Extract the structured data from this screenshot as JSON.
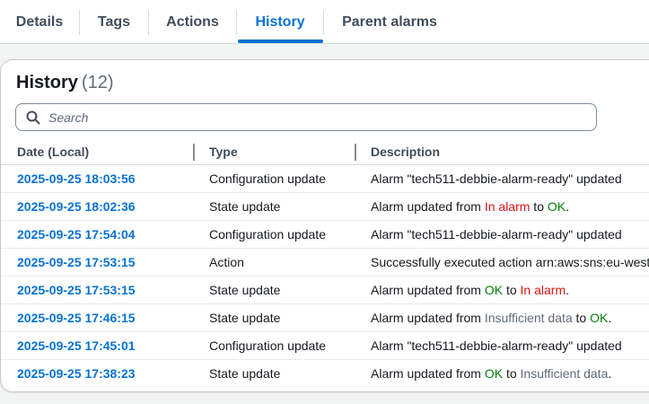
{
  "tabs": [
    {
      "label": "Details"
    },
    {
      "label": "Tags"
    },
    {
      "label": "Actions"
    },
    {
      "label": "History",
      "active": true
    },
    {
      "label": "Parent alarms"
    }
  ],
  "history": {
    "title": "History",
    "count": "(12)",
    "search_placeholder": "Search",
    "columns": {
      "date": "Date (Local)",
      "type": "Type",
      "description": "Description"
    },
    "rows": [
      {
        "date": "2025-09-25 18:03:56",
        "type": "Configuration update",
        "desc": [
          {
            "text": "Alarm \"tech511-debbie-alarm-ready\" updated"
          }
        ]
      },
      {
        "date": "2025-09-25 18:02:36",
        "type": "State update",
        "desc": [
          {
            "text": "Alarm updated from "
          },
          {
            "text": "In alarm",
            "state": "alarm"
          },
          {
            "text": " to "
          },
          {
            "text": "OK",
            "state": "ok"
          },
          {
            "text": "."
          }
        ]
      },
      {
        "date": "2025-09-25 17:54:04",
        "type": "Configuration update",
        "desc": [
          {
            "text": "Alarm \"tech511-debbie-alarm-ready\" updated"
          }
        ]
      },
      {
        "date": "2025-09-25 17:53:15",
        "type": "Action",
        "desc": [
          {
            "text": "Successfully executed action arn:aws:sns:eu-west-"
          }
        ]
      },
      {
        "date": "2025-09-25 17:53:15",
        "type": "State update",
        "desc": [
          {
            "text": "Alarm updated from "
          },
          {
            "text": "OK",
            "state": "ok"
          },
          {
            "text": " to "
          },
          {
            "text": "In alarm",
            "state": "alarm"
          },
          {
            "text": "."
          }
        ]
      },
      {
        "date": "2025-09-25 17:46:15",
        "type": "State update",
        "desc": [
          {
            "text": "Alarm updated from "
          },
          {
            "text": "Insufficient data",
            "state": "insufficient"
          },
          {
            "text": " to "
          },
          {
            "text": "OK",
            "state": "ok"
          },
          {
            "text": "."
          }
        ]
      },
      {
        "date": "2025-09-25 17:45:01",
        "type": "Configuration update",
        "desc": [
          {
            "text": "Alarm \"tech511-debbie-alarm-ready\" updated"
          }
        ]
      },
      {
        "date": "2025-09-25 17:38:23",
        "type": "State update",
        "desc": [
          {
            "text": "Alarm updated from "
          },
          {
            "text": "OK",
            "state": "ok"
          },
          {
            "text": " to "
          },
          {
            "text": "Insufficient data",
            "state": "insufficient"
          },
          {
            "text": "."
          }
        ]
      }
    ]
  },
  "colors": {
    "link_blue": "#0972d3",
    "state_alarm": "#d91515",
    "state_ok": "#037f0c",
    "state_insufficient": "#5f6b7a"
  },
  "icons": {
    "search": "search-icon"
  }
}
